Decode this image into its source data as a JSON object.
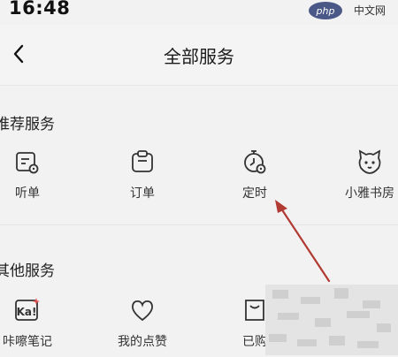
{
  "status": {
    "time": "16:48"
  },
  "watermark": {
    "text": "php 中文网"
  },
  "header": {
    "title": "全部服务"
  },
  "sections": [
    {
      "title": "推荐服务",
      "items": [
        {
          "label": "听单",
          "icon": "listen-order-icon"
        },
        {
          "label": "订单",
          "icon": "order-icon"
        },
        {
          "label": "定时",
          "icon": "timer-icon"
        },
        {
          "label": "小雅书房",
          "icon": "xiaoya-study-icon"
        }
      ]
    },
    {
      "title": "其他服务",
      "items": [
        {
          "label": "咔嚓笔记",
          "icon": "kacha-notes-icon"
        },
        {
          "label": "我的点赞",
          "icon": "heart-icon"
        },
        {
          "label": "已购",
          "icon": "purchased-icon"
        }
      ]
    }
  ],
  "colors": {
    "accent_arrow": "#b13a32",
    "background": "#f2f2f2"
  }
}
